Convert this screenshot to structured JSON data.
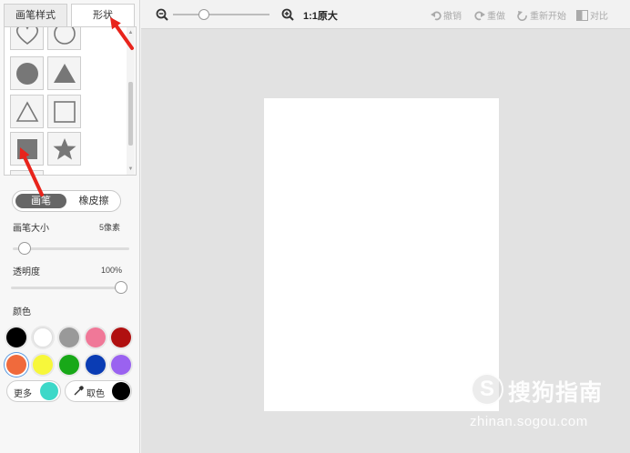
{
  "tabs": {
    "brush_style": "画笔样式",
    "shape": "形状"
  },
  "shapes": [
    {
      "name": "heart-outline-icon"
    },
    {
      "name": "circle-outline-icon"
    },
    {
      "name": "circle-filled-icon"
    },
    {
      "name": "triangle-filled-icon"
    },
    {
      "name": "triangle-outline-icon"
    },
    {
      "name": "square-outline-icon"
    },
    {
      "name": "square-filled-icon"
    },
    {
      "name": "star-filled-icon"
    }
  ],
  "mode": {
    "brush": "画笔",
    "eraser": "橡皮擦"
  },
  "brush_size": {
    "label": "画笔大小",
    "value": "5像素",
    "level_fraction": 0.05
  },
  "opacity": {
    "label": "透明度",
    "value": "100%",
    "level_fraction": 1.0
  },
  "color": {
    "label": "颜色",
    "swatches": [
      "#000000",
      "#ffffff",
      "#999999",
      "#f07898",
      "#b01010",
      "#f06a3c",
      "#f7f73a",
      "#18a818",
      "#0a3cb4",
      "#9a62f0"
    ],
    "selected": "#f06a3c",
    "more_label": "更多",
    "more_color": "#3dd8c8",
    "picker_label": "取色",
    "picker_color": "#000000"
  },
  "toolbar": {
    "zoom_ratio": "1:1",
    "original_size": "原大",
    "undo": "撤销",
    "redo": "重做",
    "restart": "重新开始",
    "compare": "对比",
    "zoom_fraction": 0.3
  },
  "watermark": {
    "brand": "搜狗指南",
    "url": "zhinan.sogou.com"
  },
  "colors": {
    "annotation_arrow": "#e8241c",
    "workspace_bg": "#e2e2e2"
  }
}
